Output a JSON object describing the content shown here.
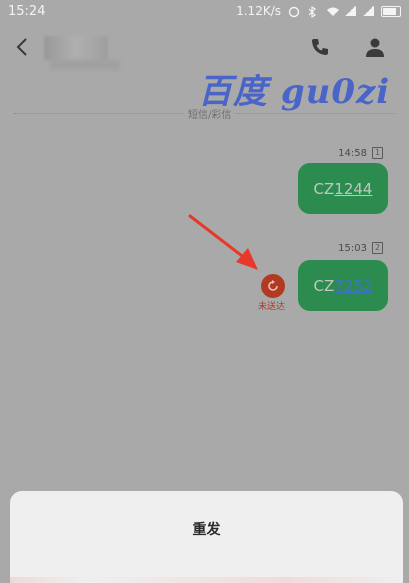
{
  "status_bar": {
    "time": "15:24",
    "net_speed": "1.12K/s"
  },
  "conversation": {
    "channel_label": "短信/彩信",
    "messages": [
      {
        "time": "14:58",
        "sim": "1",
        "prefix": "CZ",
        "number": "1244"
      },
      {
        "time": "15:03",
        "sim": "2",
        "prefix": "CZ",
        "number": "7252"
      }
    ],
    "failed_label": "未送达"
  },
  "watermark": {
    "text": "百度 gu0zi"
  },
  "sheet": {
    "resend_label": "重发"
  },
  "colors": {
    "bubble": "#2c8c4f",
    "failed": "#b23a22",
    "overlay_bg": "#a9a9a9",
    "watermark": "#4a64c8"
  },
  "icons": [
    "back-icon",
    "phone-icon",
    "person-icon",
    "resend-icon"
  ]
}
